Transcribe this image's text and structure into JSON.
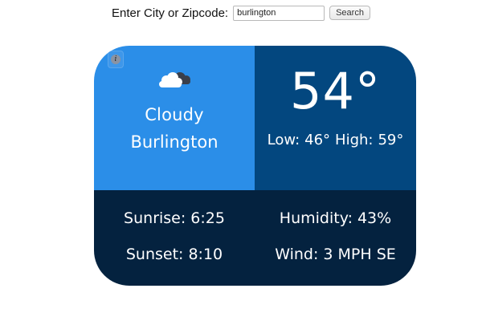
{
  "search": {
    "label": "Enter City or Zipcode:",
    "value": "burlington",
    "button_label": "Search"
  },
  "weather": {
    "condition": "Cloudy",
    "city": "Burlington",
    "condition_icon": "cloud-icon",
    "info_icon": "info-icon",
    "temperature": "54°",
    "low_label": "Low:",
    "low_value": "46°",
    "high_label": "High:",
    "high_value": "59°",
    "sunrise_label": "Sunrise:",
    "sunrise_value": "6:25",
    "sunset_label": "Sunset:",
    "sunset_value": "8:10",
    "humidity_label": "Humidity:",
    "humidity_value": "43%",
    "wind_label": "Wind:",
    "wind_value": "3 MPH SE"
  },
  "colors": {
    "conditions_panel": "#2b8ee8",
    "temperature_panel": "#03477f",
    "details_panel": "#04223f",
    "text": "#ffffff"
  }
}
